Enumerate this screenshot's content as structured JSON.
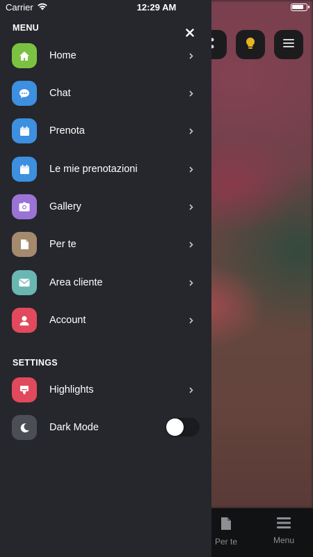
{
  "status_bar": {
    "carrier": "Carrier",
    "time": "12:29 AM",
    "battery_level": 0.85
  },
  "drawer": {
    "menu_title": "MENU",
    "settings_title": "SETTINGS",
    "close_icon": "close-icon",
    "menu_items": [
      {
        "label": "Home",
        "icon": "home-icon",
        "color": "#7cc242"
      },
      {
        "label": "Chat",
        "icon": "chat-icon",
        "color": "#3d8fe0"
      },
      {
        "label": "Prenota",
        "icon": "calendar-icon",
        "color": "#3d8fe0"
      },
      {
        "label": "Le mie prenotazioni",
        "icon": "calendar-icon",
        "color": "#3d8fe0"
      },
      {
        "label": "Gallery",
        "icon": "camera-icon",
        "color": "#9b73d6"
      },
      {
        "label": "Per te",
        "icon": "document-icon",
        "color": "#a58a6e"
      },
      {
        "label": "Area cliente",
        "icon": "mail-icon",
        "color": "#6ab7b2"
      },
      {
        "label": "Account",
        "icon": "user-icon",
        "color": "#e04a5c"
      }
    ],
    "settings_items": [
      {
        "label": "Highlights",
        "icon": "highlight-icon",
        "color": "#e04a5c"
      },
      {
        "label": "Dark Mode",
        "icon": "moon-icon",
        "color": "#4b4e55",
        "toggle_on": false
      }
    ]
  },
  "background": {
    "tabs": [
      {
        "label": "Per te",
        "icon": "document-icon"
      },
      {
        "label": "Menu",
        "icon": "menu-icon"
      }
    ],
    "top_buttons": [
      "more-icon",
      "lightbulb-icon",
      "menu-icon"
    ]
  }
}
